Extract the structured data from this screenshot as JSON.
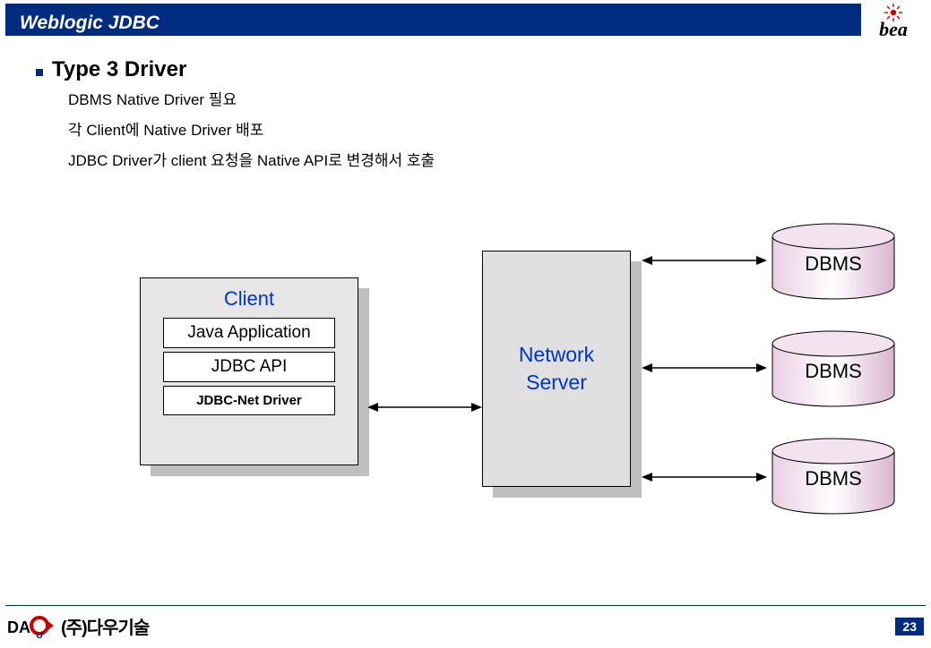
{
  "header": {
    "title": "Weblogic JDBC",
    "logo_text": "bea"
  },
  "main": {
    "heading": "Type 3 Driver",
    "bullets": [
      "DBMS Native Driver 필요",
      "각 Client에 Native Driver 배포",
      "JDBC Driver가 client 요청을  Native API로 변경해서 호출"
    ]
  },
  "diagram": {
    "client": {
      "title": "Client",
      "layers": [
        "Java Application",
        "JDBC API",
        "JDBC-Net Driver"
      ]
    },
    "server": {
      "label": "Network\nServer"
    },
    "dbms": [
      "DBMS",
      "DBMS",
      "DBMS"
    ]
  },
  "footer": {
    "company": "(주)다우기술",
    "page": "23"
  }
}
